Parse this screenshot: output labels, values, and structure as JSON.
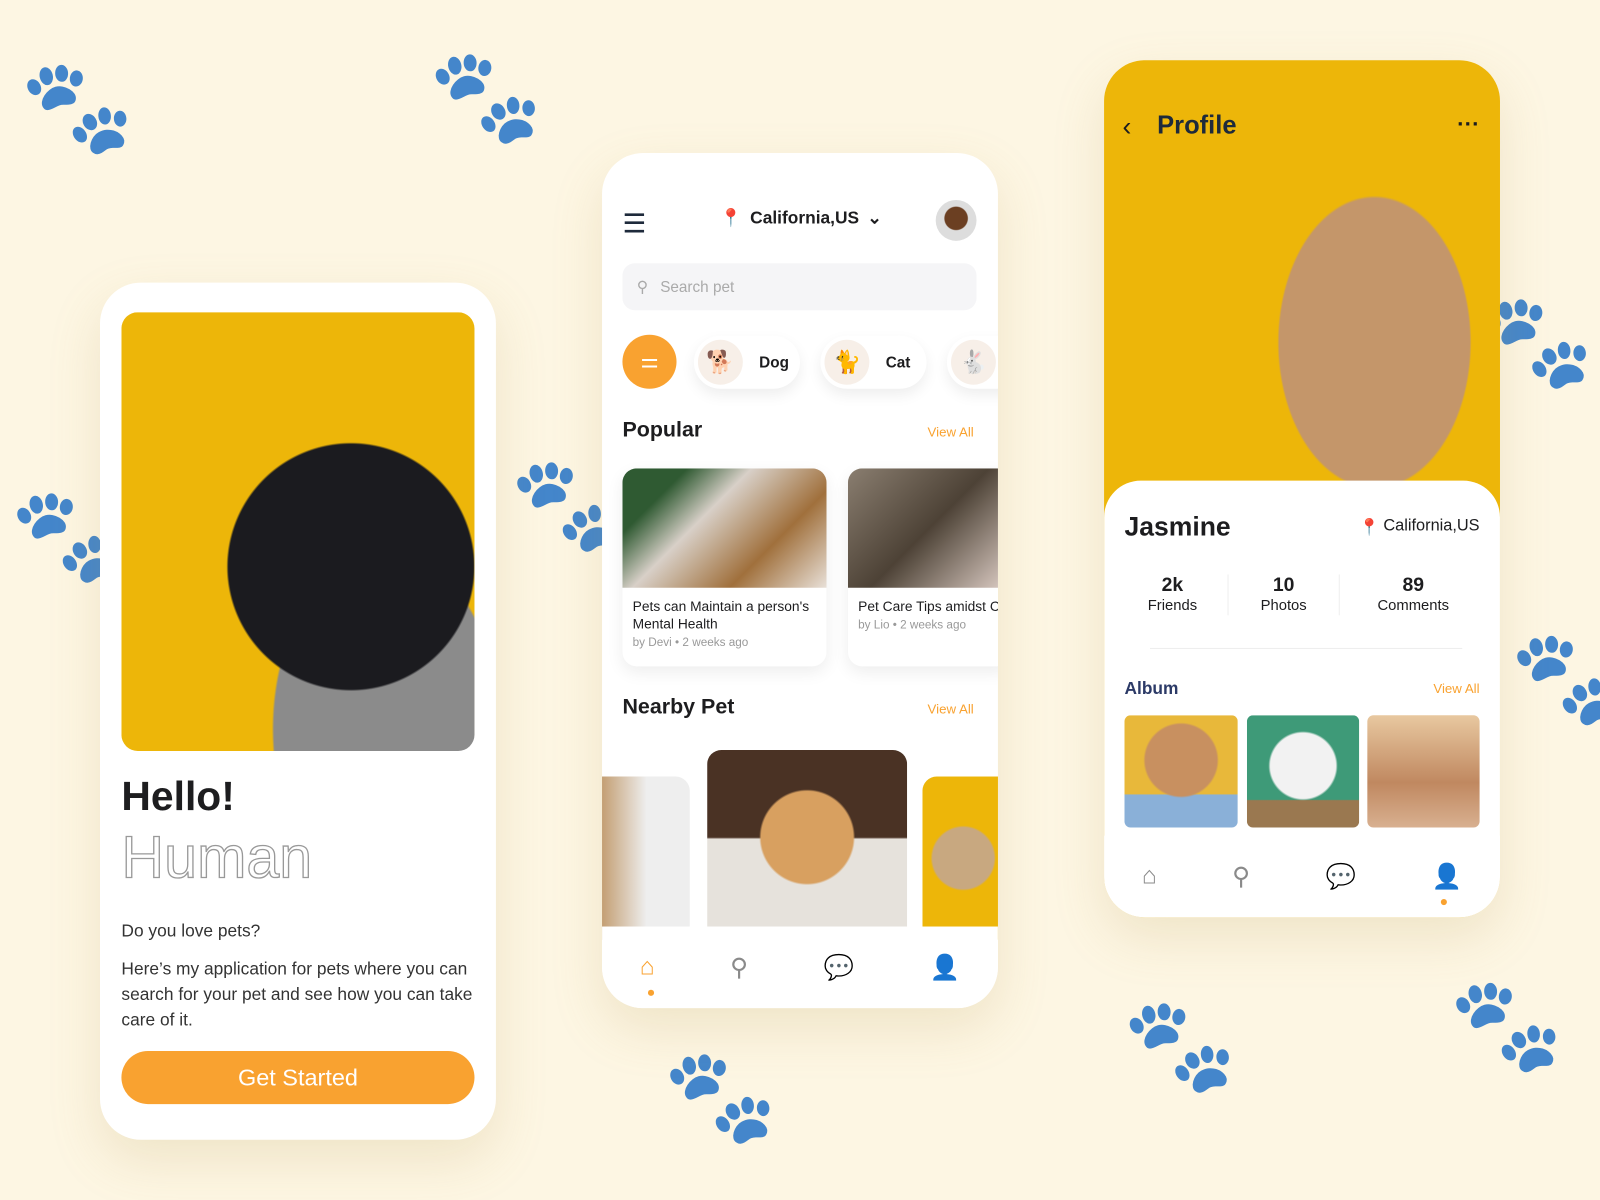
{
  "colors": {
    "accent": "#f9a230",
    "hero_yellow": "#edb609",
    "background": "#fdf6e3"
  },
  "welcome": {
    "title": "Hello!",
    "subtitle": "Human",
    "question": "Do you love pets?",
    "description": "Here’s my application for pets where you can search for your pet and see how you can take care of it.",
    "cta": "Get Started"
  },
  "home": {
    "location": "California,US",
    "search_placeholder": "Search pet",
    "categories": [
      {
        "label": "Dog",
        "icon": "🐕"
      },
      {
        "label": "Cat",
        "icon": "🐈"
      },
      {
        "label": "",
        "icon": "🐇"
      }
    ],
    "popular_title": "Popular",
    "view_all": "View All",
    "posts": [
      {
        "title": "Pets can Maintain a person's Mental Health",
        "author": "by Devi",
        "time": "• 2 weeks ago"
      },
      {
        "title": "Pet Care Tips amidst Corona Pandemic",
        "author": "by Lio",
        "time": "• 2 weeks ago"
      }
    ],
    "nearby_title": "Nearby Pet",
    "nearby_view_all": "View All"
  },
  "profile": {
    "title": "Profile",
    "name": "Jasmine",
    "location": "California,US",
    "stats": [
      {
        "value": "2k",
        "label": "Friends"
      },
      {
        "value": "10",
        "label": "Photos"
      },
      {
        "value": "89",
        "label": "Comments"
      }
    ],
    "album_title": "Album",
    "view_all": "View All"
  }
}
